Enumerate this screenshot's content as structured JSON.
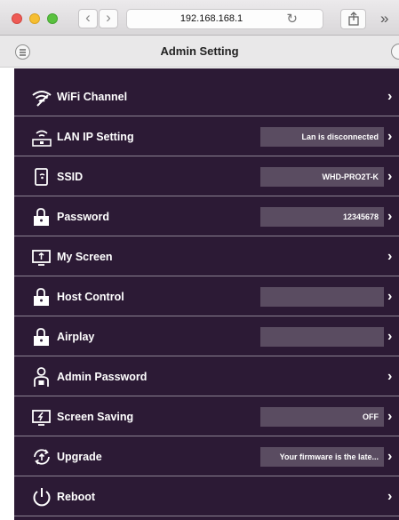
{
  "browser": {
    "url": "192.168.168.1",
    "back_glyph": "‹",
    "forward_glyph": "›",
    "reload_glyph": "↻",
    "more_glyph": "»"
  },
  "app": {
    "title": "Admin Setting"
  },
  "settings": [
    {
      "label": "WiFi Channel",
      "value": null,
      "icon": "wifi-icon"
    },
    {
      "label": "LAN IP Setting",
      "value": "Lan is disconnected",
      "icon": "lan-icon"
    },
    {
      "label": "SSID",
      "value": "WHD-PRO2T-K",
      "icon": "device-icon"
    },
    {
      "label": "Password",
      "value": "12345678",
      "icon": "lock-icon"
    },
    {
      "label": "My Screen",
      "value": null,
      "icon": "screen-icon"
    },
    {
      "label": "Host Control",
      "value": "",
      "icon": "lock-icon"
    },
    {
      "label": "Airplay",
      "value": "",
      "icon": "lock-icon"
    },
    {
      "label": "Admin Password",
      "value": null,
      "icon": "user-lock-icon"
    },
    {
      "label": "Screen Saving",
      "value": "OFF",
      "icon": "screen-saver-icon"
    },
    {
      "label": "Upgrade",
      "value": "Your firmware is the late...",
      "icon": "upgrade-icon"
    },
    {
      "label": "Reboot",
      "value": null,
      "icon": "power-icon"
    }
  ],
  "chevron": "›",
  "colors": {
    "panel_bg": "#2c1a35",
    "value_box_bg": "#5a4c61",
    "divider": "#8d8393"
  }
}
